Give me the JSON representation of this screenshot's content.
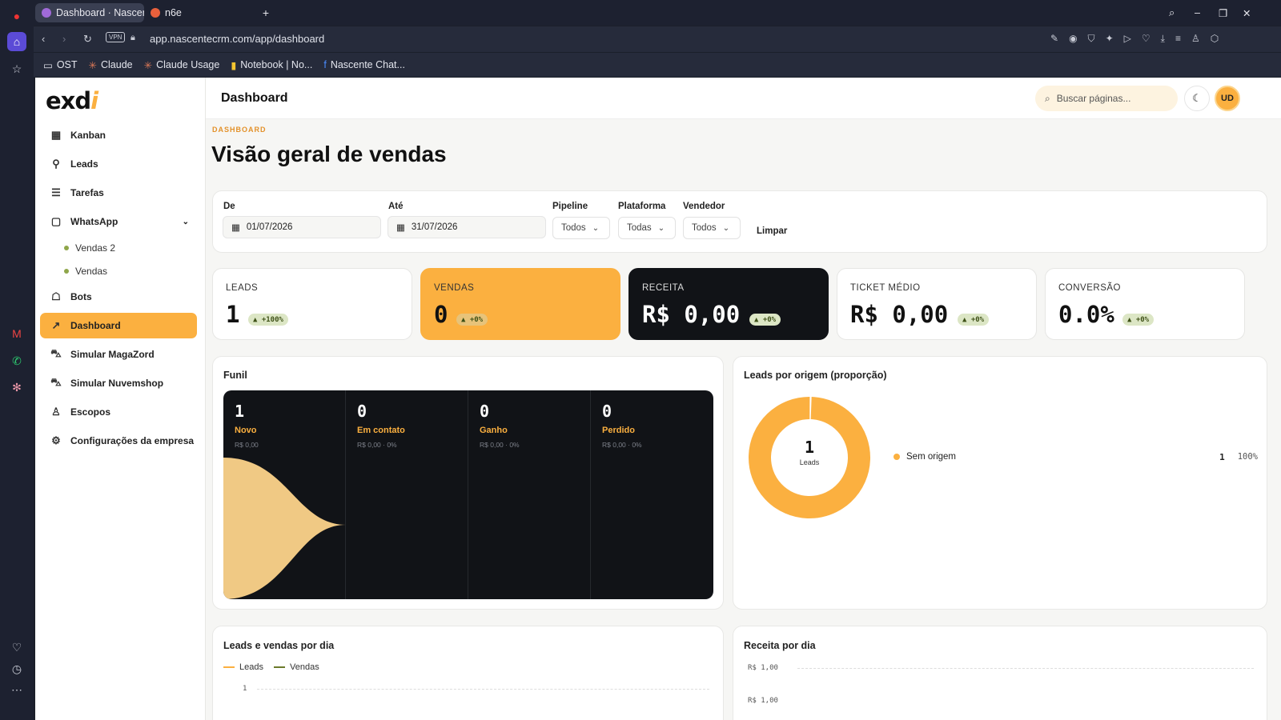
{
  "browser": {
    "tabs": [
      {
        "title": "Dashboard · Nascent",
        "color": "#a06ad8"
      },
      {
        "title": "n6e",
        "color": "#e8603c"
      }
    ],
    "url": "app.nascentecrm.com/app/dashboard",
    "vpn_label": "VPN",
    "bookmarks": [
      {
        "label": "OST",
        "icon": "folder-icon"
      },
      {
        "label": "Claude",
        "icon": "claude-icon"
      },
      {
        "label": "Claude Usage",
        "icon": "claude-icon"
      },
      {
        "label": "Notebook | No...",
        "icon": "notebook-icon"
      },
      {
        "label": "Nascente Chat...",
        "icon": "facebook-icon"
      }
    ]
  },
  "brand": {
    "logo_main": "exd",
    "logo_accent": "i",
    "accent": "#fbb040"
  },
  "sidebar": {
    "items": [
      {
        "label": "Kanban",
        "icon": "kanban-icon"
      },
      {
        "label": "Leads",
        "icon": "user-search-icon"
      },
      {
        "label": "Tarefas",
        "icon": "tasks-icon"
      },
      {
        "label": "WhatsApp",
        "icon": "chat-icon"
      },
      {
        "label": "Bots",
        "icon": "bot-icon"
      },
      {
        "label": "Dashboard",
        "icon": "chart-icon"
      },
      {
        "label": "Simular MagaZord",
        "icon": "cart-icon"
      },
      {
        "label": "Simular Nuvemshop",
        "icon": "cart-icon"
      },
      {
        "label": "Escopos",
        "icon": "users-icon"
      },
      {
        "label": "Configurações da empresa",
        "icon": "gear-icon"
      }
    ],
    "whatsapp_sub": [
      "Vendas 2",
      "Vendas"
    ],
    "active": "Dashboard"
  },
  "topbar": {
    "title": "Dashboard",
    "search_placeholder": "Buscar páginas...",
    "avatar": "UD"
  },
  "page": {
    "eyebrow": "DASHBOARD",
    "heading": "Visão geral de vendas"
  },
  "filters": {
    "from_label": "De",
    "from_value": "01/07/2026",
    "to_label": "Até",
    "to_value": "31/07/2026",
    "pipeline_label": "Pipeline",
    "pipeline_value": "Todos",
    "platform_label": "Plataforma",
    "platform_value": "Todas",
    "seller_label": "Vendedor",
    "seller_value": "Todos",
    "clear": "Limpar"
  },
  "kpis": [
    {
      "label": "LEADS",
      "value": "1",
      "badge": "▲ +100%",
      "theme": "light"
    },
    {
      "label": "VENDAS",
      "value": "0",
      "badge": "▲ +0%",
      "theme": "accent"
    },
    {
      "label": "RECEITA",
      "value": "R$ 0,00",
      "badge": "▲ +0%",
      "theme": "dark"
    },
    {
      "label": "TICKET MÉDIO",
      "value": "R$ 0,00",
      "badge": "▲ +0%",
      "theme": "light"
    },
    {
      "label": "CONVERSÃO",
      "value": "0.0%",
      "badge": "▲ +0%",
      "theme": "light"
    }
  ],
  "funnel": {
    "title": "Funil",
    "stages": [
      {
        "count": "1",
        "name": "Novo",
        "sub": "R$ 0,00"
      },
      {
        "count": "0",
        "name": "Em contato",
        "sub": "R$ 0,00 · 0%"
      },
      {
        "count": "0",
        "name": "Ganho",
        "sub": "R$ 0,00 · 0%"
      },
      {
        "count": "0",
        "name": "Perdido",
        "sub": "R$ 0,00 · 0%"
      }
    ]
  },
  "origin": {
    "title": "Leads por origem (proporção)",
    "center_value": "1",
    "center_label": "Leads",
    "legend": [
      {
        "name": "Sem origem",
        "count": "1",
        "pct": "100%",
        "color": "#fbb040"
      }
    ]
  },
  "chart_data": [
    {
      "type": "pie",
      "title": "Leads por origem (proporção)",
      "categories": [
        "Sem origem"
      ],
      "values": [
        1
      ],
      "colors": [
        "#fbb040"
      ]
    },
    {
      "type": "line",
      "title": "Leads e vendas por dia",
      "series": [
        {
          "name": "Leads",
          "color": "#fbb040"
        },
        {
          "name": "Vendas",
          "color": "#6b7a2a"
        }
      ],
      "y_ticks": [
        "1"
      ]
    },
    {
      "type": "line",
      "title": "Receita por dia",
      "y_ticks": [
        "R$ 1,00",
        "R$ 1,00"
      ]
    }
  ],
  "charts": {
    "daily_title": "Leads e vendas por dia",
    "daily_legend": [
      "Leads",
      "Vendas"
    ],
    "daily_tick": "1",
    "revenue_title": "Receita por dia",
    "revenue_ticks": [
      "R$ 1,00",
      "R$ 1,00"
    ]
  }
}
